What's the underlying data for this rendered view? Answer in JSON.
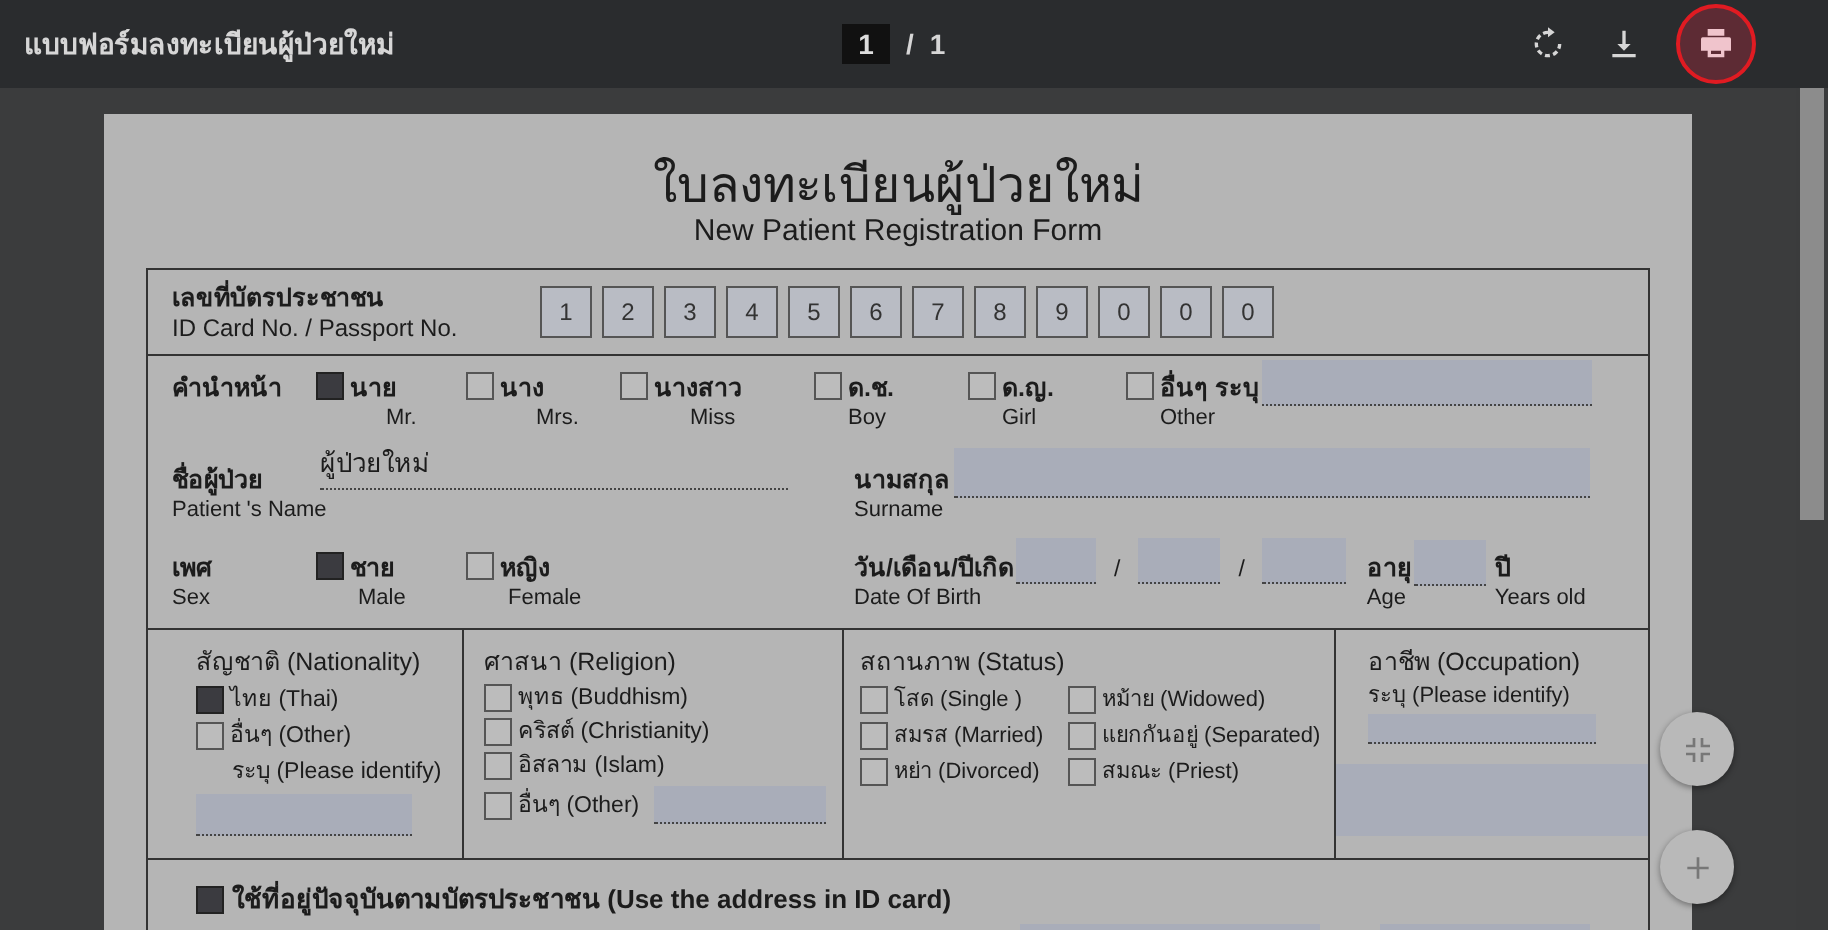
{
  "toolbar": {
    "title": "แบบฟอร์มลงทะเบียนผู้ป่วยใหม่",
    "page_current": "1",
    "page_separator": "/",
    "page_total": "1"
  },
  "form": {
    "title": "ใบลงทะเบียนผู้ป่วยใหม่",
    "subtitle": "New Patient Registration Form",
    "id_card": {
      "label": "เลขที่บัตรประชาชน",
      "label_en": "ID Card No. / Passport  No.",
      "digits": [
        "1",
        "2",
        "3",
        "4",
        "5",
        "6",
        "7",
        "8",
        "9",
        "0",
        "0",
        "0"
      ]
    },
    "prefix": {
      "label": "คำนำหน้า",
      "options": [
        {
          "label": "นาย",
          "label_en": "Mr.",
          "checked": true
        },
        {
          "label": "นาง",
          "label_en": "Mrs.",
          "checked": false
        },
        {
          "label": "นางสาว",
          "label_en": "Miss",
          "checked": false
        },
        {
          "label": "ด.ช.",
          "label_en": "Boy",
          "checked": false
        },
        {
          "label": "ด.ญ.",
          "label_en": "Girl",
          "checked": false
        },
        {
          "label": "อื่นๆ ระบุ",
          "label_en": "Other",
          "checked": false
        }
      ]
    },
    "name": {
      "label": "ชื่อผู้ป่วย",
      "label_en": "Patient 's Name",
      "value": "ผู้ป่วยใหม่"
    },
    "surname": {
      "label": "นามสกุล",
      "label_en": "Surname"
    },
    "sex": {
      "label": "เพศ",
      "label_en": "Sex",
      "options": [
        {
          "label": "ชาย",
          "label_en": "Male",
          "checked": true
        },
        {
          "label": "หญิง",
          "label_en": "Female",
          "checked": false
        }
      ]
    },
    "birth_date": {
      "label": "วัน/เดือน/ปีเกิด",
      "label_en": "Date Of  Birth",
      "separators": [
        "/",
        "/"
      ]
    },
    "age": {
      "label": "อายุ",
      "label_en": "Age",
      "unit": "ปี",
      "unit_en": "Years old"
    },
    "nationality": {
      "title": "สัญชาติ (Nationality)",
      "options": [
        {
          "label": "ไทย (Thai)",
          "checked": true
        },
        {
          "label": "อื่นๆ (Other)",
          "checked": false
        }
      ],
      "identify_label": "ระบุ (Please identify)"
    },
    "religion": {
      "title": "ศาสนา (Religion)",
      "options": [
        {
          "label": "พุทธ (Buddhism)",
          "checked": false
        },
        {
          "label": "คริสต์ (Christianity)",
          "checked": false
        },
        {
          "label": "อิสลาม (Islam)",
          "checked": false
        },
        {
          "label": "อื่นๆ (Other)",
          "checked": false
        }
      ]
    },
    "status": {
      "title": "สถานภาพ (Status)",
      "options": [
        {
          "label": "โสด (Single )",
          "checked": false
        },
        {
          "label": "หม้าย (Widowed)",
          "checked": false
        },
        {
          "label": "สมรส (Married)",
          "checked": false
        },
        {
          "label": "แยกกันอยู่ (Separated)",
          "checked": false
        },
        {
          "label": "หย่า (Divorced)",
          "checked": false
        },
        {
          "label": "สมณะ (Priest)",
          "checked": false
        }
      ]
    },
    "occupation": {
      "title": "อาชีพ (Occupation)",
      "identify_label": "ระบุ (Please identify)"
    },
    "address": {
      "label": "ใช้ที่อยู่ปัจจุบันตามบัตรประชาชน (Use the address in ID card)",
      "checked": true
    }
  }
}
